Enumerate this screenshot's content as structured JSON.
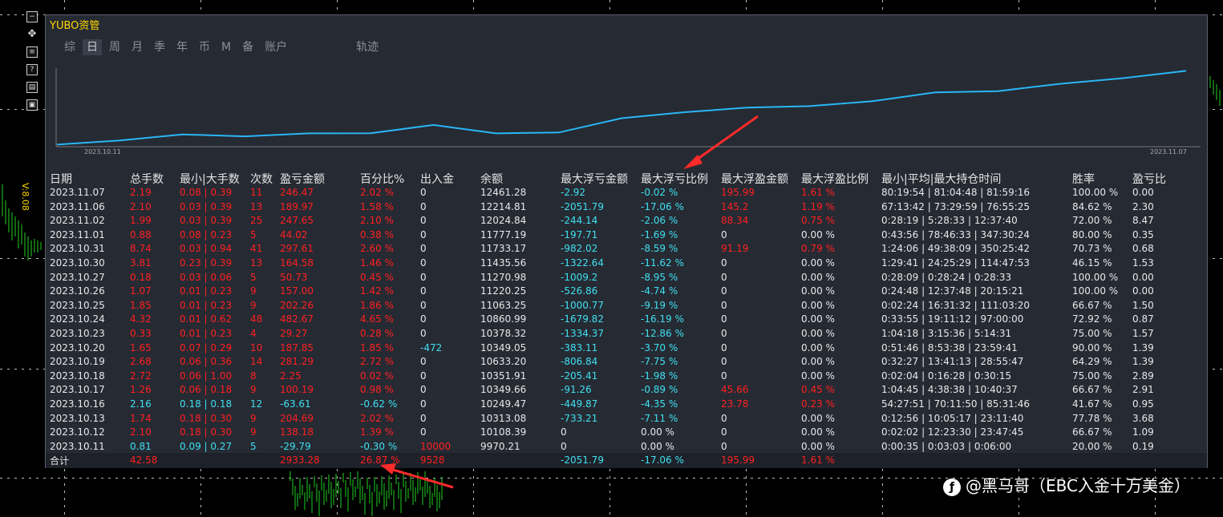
{
  "app": {
    "title": "YUBO资管",
    "side_label": "V:8.08"
  },
  "tabs": [
    {
      "label": "综",
      "active": false
    },
    {
      "label": "日",
      "active": true
    },
    {
      "label": "周",
      "active": false
    },
    {
      "label": "月",
      "active": false
    },
    {
      "label": "季",
      "active": false
    },
    {
      "label": "年",
      "active": false
    },
    {
      "label": "币",
      "active": false
    },
    {
      "label": "M",
      "active": false
    },
    {
      "label": "备",
      "active": false
    },
    {
      "label": "账户",
      "active": false
    },
    {
      "label": "轨迹",
      "active": false
    }
  ],
  "chart": {
    "start_label": "2023.10.11",
    "end_label": "2023.11.07",
    "line_color": "#29b6f6"
  },
  "table": {
    "headers": [
      "日期",
      "总手数",
      "最小|大手数",
      "次数",
      "盈亏金额",
      "百分比%",
      "出入金",
      "余额",
      "最大浮亏金额",
      "最大浮亏比例",
      "最大浮盈金额",
      "最大浮盈比例",
      "最小|平均|最大持仓时间",
      "胜率",
      "盈亏比"
    ],
    "rows": [
      {
        "date": "2023.11.07",
        "lots": "2.19",
        "minmax": "0.08 | 0.39",
        "count": "11",
        "pnl": "246.47",
        "pct": "2.02 %",
        "io": "0",
        "bal": "12461.28",
        "maxloss": "-2.92",
        "maxloss_pct": "-0.02 %",
        "maxgain": "195.99",
        "maxgain_pct": "1.61 %",
        "hold": "80:19:54 | 81:04:48 | 81:59:16",
        "win": "100.00 %",
        "ratio": "0.00",
        "pos": true
      },
      {
        "date": "2023.11.06",
        "lots": "2.10",
        "minmax": "0.03 | 0.39",
        "count": "13",
        "pnl": "189.97",
        "pct": "1.58 %",
        "io": "0",
        "bal": "12214.81",
        "maxloss": "-2051.79",
        "maxloss_pct": "-17.06 %",
        "maxgain": "145.2",
        "maxgain_pct": "1.19 %",
        "hold": "67:13:42 | 73:29:59 | 76:55:25",
        "win": "84.62 %",
        "ratio": "2.30",
        "pos": true
      },
      {
        "date": "2023.11.02",
        "lots": "1.99",
        "minmax": "0.03 | 0.39",
        "count": "25",
        "pnl": "247.65",
        "pct": "2.10 %",
        "io": "0",
        "bal": "12024.84",
        "maxloss": "-244.14",
        "maxloss_pct": "-2.06 %",
        "maxgain": "88.34",
        "maxgain_pct": "0.75 %",
        "hold": "0:28:19 | 5:28:33 | 12:37:40",
        "win": "72.00 %",
        "ratio": "8.47",
        "pos": true
      },
      {
        "date": "2023.11.01",
        "lots": "0.88",
        "minmax": "0.08 | 0.23",
        "count": "5",
        "pnl": "44.02",
        "pct": "0.38 %",
        "io": "0",
        "bal": "11777.19",
        "maxloss": "-197.71",
        "maxloss_pct": "-1.69 %",
        "maxgain": "0",
        "maxgain_pct": "0.00 %",
        "hold": "0:43:56 | 78:46:33 | 347:30:24",
        "win": "80.00 %",
        "ratio": "0.35",
        "pos": true
      },
      {
        "date": "2023.10.31",
        "lots": "8.74",
        "minmax": "0.03 | 0.94",
        "count": "41",
        "pnl": "297.61",
        "pct": "2.60 %",
        "io": "0",
        "bal": "11733.17",
        "maxloss": "-982.02",
        "maxloss_pct": "-8.59 %",
        "maxgain": "91.19",
        "maxgain_pct": "0.79 %",
        "hold": "1:24:06 | 49:38:09 | 350:25:42",
        "win": "70.73 %",
        "ratio": "0.68",
        "pos": true
      },
      {
        "date": "2023.10.30",
        "lots": "3.81",
        "minmax": "0.23 | 0.39",
        "count": "13",
        "pnl": "164.58",
        "pct": "1.46 %",
        "io": "0",
        "bal": "11435.56",
        "maxloss": "-1322.64",
        "maxloss_pct": "-11.62 %",
        "maxgain": "0",
        "maxgain_pct": "0.00 %",
        "hold": "1:29:41 | 24:25:29 | 114:47:53",
        "win": "46.15 %",
        "ratio": "1.53",
        "pos": true
      },
      {
        "date": "2023.10.27",
        "lots": "0.18",
        "minmax": "0.03 | 0.06",
        "count": "5",
        "pnl": "50.73",
        "pct": "0.45 %",
        "io": "0",
        "bal": "11270.98",
        "maxloss": "-1009.2",
        "maxloss_pct": "-8.95 %",
        "maxgain": "0",
        "maxgain_pct": "0.00 %",
        "hold": "0:28:09 | 0:28:24 | 0:28:33",
        "win": "100.00 %",
        "ratio": "0.00",
        "pos": true
      },
      {
        "date": "2023.10.26",
        "lots": "1.07",
        "minmax": "0.01 | 0.23",
        "count": "9",
        "pnl": "157.00",
        "pct": "1.42 %",
        "io": "0",
        "bal": "11220.25",
        "maxloss": "-526.86",
        "maxloss_pct": "-4.74 %",
        "maxgain": "0",
        "maxgain_pct": "0.00 %",
        "hold": "0:24:48 | 12:37:48 | 20:15:21",
        "win": "100.00 %",
        "ratio": "0.00",
        "pos": true
      },
      {
        "date": "2023.10.25",
        "lots": "1.85",
        "minmax": "0.01 | 0.23",
        "count": "9",
        "pnl": "202.26",
        "pct": "1.86 %",
        "io": "0",
        "bal": "11063.25",
        "maxloss": "-1000.77",
        "maxloss_pct": "-9.19 %",
        "maxgain": "0",
        "maxgain_pct": "0.00 %",
        "hold": "0:02:24 | 16:31:32 | 111:03:20",
        "win": "66.67 %",
        "ratio": "1.50",
        "pos": true
      },
      {
        "date": "2023.10.24",
        "lots": "4.32",
        "minmax": "0.01 | 0.62",
        "count": "48",
        "pnl": "482.67",
        "pct": "4.65 %",
        "io": "0",
        "bal": "10860.99",
        "maxloss": "-1679.82",
        "maxloss_pct": "-16.19 %",
        "maxgain": "0",
        "maxgain_pct": "0.00 %",
        "hold": "0:33:55 | 19:11:12 | 97:00:00",
        "win": "72.92 %",
        "ratio": "0.87",
        "pos": true
      },
      {
        "date": "2023.10.23",
        "lots": "0.33",
        "minmax": "0.01 | 0.23",
        "count": "4",
        "pnl": "29.27",
        "pct": "0.28 %",
        "io": "0",
        "bal": "10378.32",
        "maxloss": "-1334.37",
        "maxloss_pct": "-12.86 %",
        "maxgain": "0",
        "maxgain_pct": "0.00 %",
        "hold": "1:04:18 | 3:15:36 | 5:14:31",
        "win": "75.00 %",
        "ratio": "1.57",
        "pos": true
      },
      {
        "date": "2023.10.20",
        "lots": "1.65",
        "minmax": "0.07 | 0.29",
        "count": "10",
        "pnl": "187.85",
        "pct": "1.85 %",
        "io": "-472",
        "bal": "10349.05",
        "maxloss": "-383.11",
        "maxloss_pct": "-3.70 %",
        "maxgain": "0",
        "maxgain_pct": "0.00 %",
        "hold": "0:51:46 | 8:53:38 | 23:59:41",
        "win": "90.00 %",
        "ratio": "1.39",
        "pos": true
      },
      {
        "date": "2023.10.19",
        "lots": "2.68",
        "minmax": "0.06 | 0.36",
        "count": "14",
        "pnl": "281.29",
        "pct": "2.72 %",
        "io": "0",
        "bal": "10633.20",
        "maxloss": "-806.84",
        "maxloss_pct": "-7.75 %",
        "maxgain": "0",
        "maxgain_pct": "0.00 %",
        "hold": "0:32:27 | 13:41:13 | 28:55:47",
        "win": "64.29 %",
        "ratio": "1.39",
        "pos": true
      },
      {
        "date": "2023.10.18",
        "lots": "2.72",
        "minmax": "0.06 | 1.00",
        "count": "8",
        "pnl": "2.25",
        "pct": "0.02 %",
        "io": "0",
        "bal": "10351.91",
        "maxloss": "-205.41",
        "maxloss_pct": "-1.98 %",
        "maxgain": "0",
        "maxgain_pct": "0.00 %",
        "hold": "0:02:04 | 0:16:28 | 0:30:15",
        "win": "75.00 %",
        "ratio": "2.89",
        "pos": true
      },
      {
        "date": "2023.10.17",
        "lots": "1.26",
        "minmax": "0.06 | 0.18",
        "count": "9",
        "pnl": "100.19",
        "pct": "0.98 %",
        "io": "0",
        "bal": "10349.66",
        "maxloss": "-91.26",
        "maxloss_pct": "-0.89 %",
        "maxgain": "45.66",
        "maxgain_pct": "0.45 %",
        "hold": "1:04:45 | 4:38:38 | 10:40:37",
        "win": "66.67 %",
        "ratio": "2.91",
        "pos": true
      },
      {
        "date": "2023.10.16",
        "lots": "2.16",
        "minmax": "0.18 | 0.18",
        "count": "12",
        "pnl": "-63.61",
        "pct": "-0.62 %",
        "io": "0",
        "bal": "10249.47",
        "maxloss": "-449.87",
        "maxloss_pct": "-4.35 %",
        "maxgain": "23.78",
        "maxgain_pct": "0.23 %",
        "hold": "54:27:51 | 70:11:50 | 85:31:46",
        "win": "41.67 %",
        "ratio": "0.95",
        "pos": false
      },
      {
        "date": "2023.10.13",
        "lots": "1.74",
        "minmax": "0.18 | 0.30",
        "count": "9",
        "pnl": "204.69",
        "pct": "2.02 %",
        "io": "0",
        "bal": "10313.08",
        "maxloss": "-733.21",
        "maxloss_pct": "-7.11 %",
        "maxgain": "0",
        "maxgain_pct": "0.00 %",
        "hold": "0:12:56 | 10:05:17 | 23:11:40",
        "win": "77.78 %",
        "ratio": "3.68",
        "pos": true
      },
      {
        "date": "2023.10.12",
        "lots": "2.10",
        "minmax": "0.18 | 0.30",
        "count": "9",
        "pnl": "138.18",
        "pct": "1.39 %",
        "io": "0",
        "bal": "10108.39",
        "maxloss": "0",
        "maxloss_pct": "0.00 %",
        "maxgain": "0",
        "maxgain_pct": "0.00 %",
        "hold": "0:02:02 | 12:23:30 | 23:47:45",
        "win": "66.67 %",
        "ratio": "1.09",
        "pos": true
      },
      {
        "date": "2023.10.11",
        "lots": "0.81",
        "minmax": "0.09 | 0.27",
        "count": "5",
        "pnl": "-29.79",
        "pct": "-0.30 %",
        "io": "10000",
        "bal": "9970.21",
        "maxloss": "0",
        "maxloss_pct": "0.00 %",
        "maxgain": "0",
        "maxgain_pct": "0.00 %",
        "hold": "0:00:35 | 0:03:03 | 0:06:00",
        "win": "20.00 %",
        "ratio": "0.19",
        "pos": false
      }
    ],
    "total": {
      "label": "合计",
      "lots": "42.58",
      "pnl": "2933.28",
      "pct": "26.87 %",
      "io": "9528",
      "maxloss": "-2051.79",
      "maxloss_pct": "-17.06 %",
      "maxgain": "195.99",
      "maxgain_pct": "1.61 %"
    }
  },
  "watermark": {
    "icon": "social-icon",
    "text": "@黑马哥（EBC入金十万美金）"
  },
  "colors": {
    "positive": "#ff2020",
    "negative": "#3fe0f0",
    "accent": "#ffd800"
  }
}
